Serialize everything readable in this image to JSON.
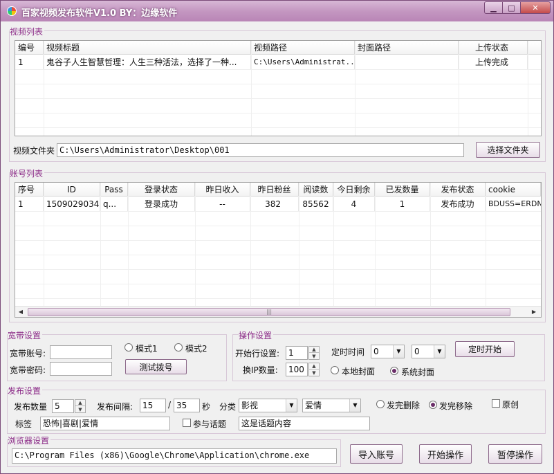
{
  "window": {
    "title": "百家视频发布软件V1.0 BY：边缘软件",
    "min_label": "▁",
    "max_label": "□",
    "close_label": "✕"
  },
  "video_list": {
    "group_label": "视频列表",
    "columns": [
      "编号",
      "视频标题",
      "视频路径",
      "封面路径",
      "上传状态"
    ],
    "rows": [
      [
        "1",
        "鬼谷子人生智慧哲理：人生三种活法，选择了一种...",
        "C:\\Users\\Administrat...",
        "",
        "上传完成"
      ]
    ]
  },
  "video_folder": {
    "label": "视频文件夹",
    "value": "C:\\Users\\Administrator\\Desktop\\001",
    "button": "选择文件夹"
  },
  "account_list": {
    "group_label": "账号列表",
    "columns": [
      "序号",
      "ID",
      "Pass",
      "登录状态",
      "昨日收入",
      "昨日粉丝",
      "阅读数",
      "今日剩余",
      "已发数量",
      "发布状态",
      "cookie"
    ],
    "rows": [
      [
        "1",
        "15090290345",
        "q...",
        "登录成功",
        "--",
        "382",
        "85562",
        "4",
        "1",
        "发布成功",
        "BDUSS=ERDNn..."
      ]
    ],
    "scroll_left": "◀",
    "scroll_right": "▶",
    "thumb_grip": "|||"
  },
  "broadband": {
    "group_label": "宽带设置",
    "account_label": "宽带账号:",
    "account_value": "",
    "password_label": "宽带密码:",
    "password_value": "",
    "mode1": "模式1",
    "mode2": "模式2",
    "test_button": "测试拨号"
  },
  "operation": {
    "group_label": "操作设置",
    "start_row_label": "开始行设置:",
    "start_row_value": "1",
    "timer_label": "定时时间",
    "timer_hour": "0",
    "timer_minute": "0",
    "timer_button": "定时开始",
    "ip_count_label": "换IP数量:",
    "ip_count_value": "100",
    "local_cover": "本地封面",
    "system_cover": "系统封面"
  },
  "publish": {
    "group_label": "发布设置",
    "count_label": "发布数量",
    "count_value": "5",
    "interval_label": "发布间隔:",
    "interval_min": "15",
    "interval_sep": "/",
    "interval_max": "35",
    "seconds_label": "秒",
    "category_label": "分类",
    "category_value": "影视",
    "subcategory_value": "爱情",
    "delete_after": "发完删除",
    "move_after": "发完移除",
    "original": "原创",
    "tags_label": "标签",
    "tags_value": "恐怖|喜剧|爱情",
    "topic_label": "参与话题",
    "topic_value": "这是话题内容"
  },
  "browser": {
    "group_label": "浏览器设置",
    "path_value": "C:\\Program Files (x86)\\Google\\Chrome\\Application\\chrome.exe",
    "import_button": "导入账号",
    "start_button": "开始操作",
    "pause_button": "暂停操作"
  },
  "icons": {
    "app": "app-logo-icon",
    "spin_up": "▲",
    "spin_down": "▼",
    "dropdown": "▼"
  }
}
